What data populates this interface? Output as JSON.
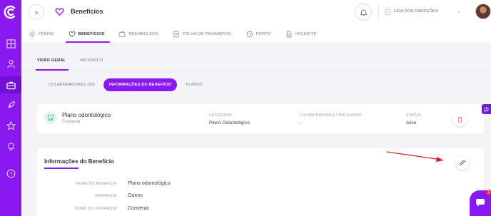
{
  "header": {
    "page_title": "Benefícios",
    "company_name": "LIGA DOS CAMPEÕES"
  },
  "module_tabs": [
    {
      "label": "FÉRIAS",
      "icon": "sun-icon"
    },
    {
      "label": "BENEFÍCIOS",
      "icon": "heart-icon",
      "active": true
    },
    {
      "label": "REEMBOLSOS",
      "icon": "wallet-icon"
    },
    {
      "label": "FOLHA DE PAGAMENTO",
      "icon": "document-icon"
    },
    {
      "label": "PONTO",
      "icon": "clock-icon"
    },
    {
      "label": "HOLERITE",
      "icon": "file-icon"
    }
  ],
  "sub_tabs": [
    {
      "label": "VISÃO GERAL",
      "active": true
    },
    {
      "label": "HISTÓRICO"
    }
  ],
  "pills": [
    {
      "label": "COLABORADORES (28)"
    },
    {
      "label": "INFORMAÇÕES DO BENEFÍCIO",
      "active": true
    },
    {
      "label": "PLANOS"
    }
  ],
  "plan_card": {
    "name": "Plano odontológico",
    "operator": "Convenia",
    "category_header": "CATEGORIA",
    "category_value": "Plano Odontológico",
    "linked_header": "COLABORADORES VINCULADOS",
    "linked_value": "-",
    "status_header": "STATUS",
    "status_value": "Ativo"
  },
  "info_card": {
    "title": "Informações do Benefício",
    "rows": [
      {
        "label": "NOME DO BENEFÍCIO",
        "value": "Plano odontológico"
      },
      {
        "label": "OPERADOR",
        "value": "Outros"
      },
      {
        "label": "NOME DO OPERADOR",
        "value": "Convenia"
      }
    ]
  },
  "chat_badge": "1",
  "colors": {
    "brand": "#8a19f0",
    "annotation_arrow": "#e02020"
  }
}
